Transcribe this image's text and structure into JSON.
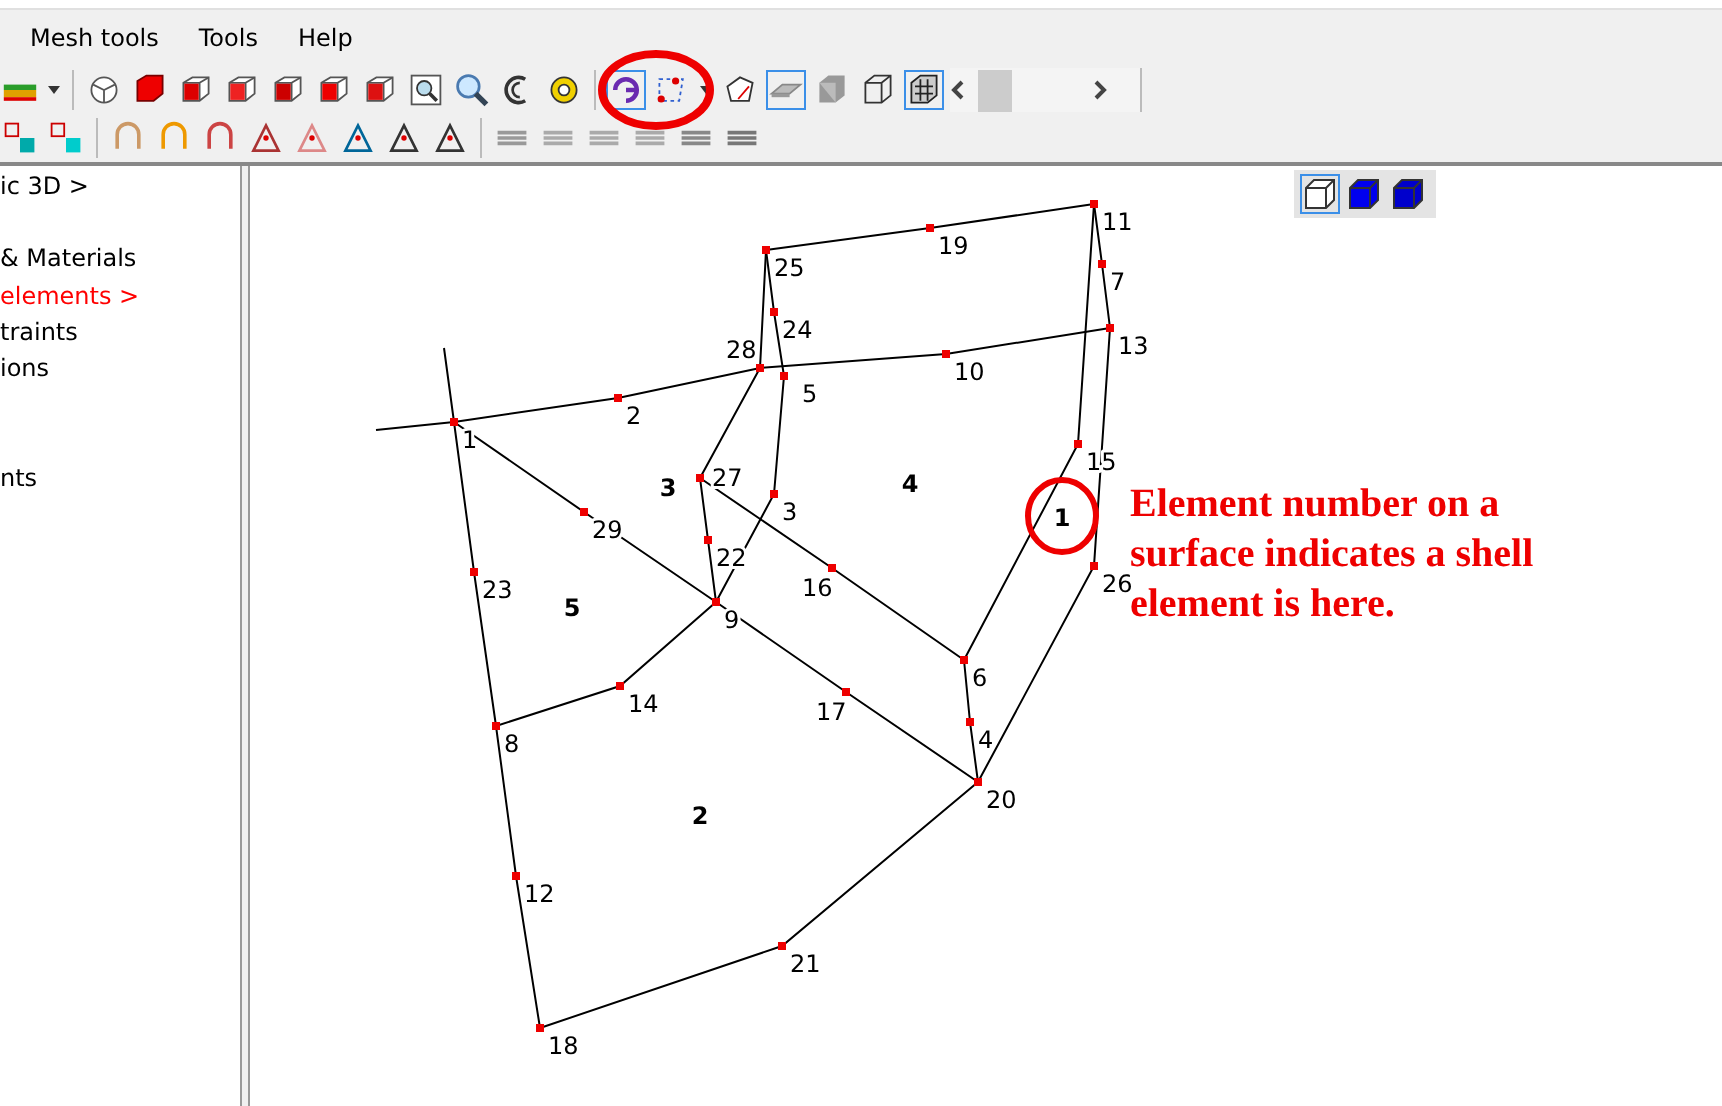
{
  "menu": [
    {
      "label": "Mesh tools"
    },
    {
      "label": "Tools"
    },
    {
      "label": "Help"
    }
  ],
  "toolbar_1": [
    {
      "selected": false
    },
    {
      "selected": false
    },
    {
      "selected": false
    },
    {
      "selected": false
    },
    {
      "selected": false
    },
    {
      "selected": false
    },
    {
      "selected": false
    },
    {
      "selected": false
    },
    {
      "selected": false
    },
    {
      "selected": false
    },
    {
      "selected": false
    },
    {
      "selected": false
    },
    {
      "selected": true
    },
    {
      "selected": false
    },
    {
      "selected": false
    },
    {
      "selected": true
    },
    {
      "selected": false
    },
    {
      "selected": false
    },
    {
      "selected": true
    }
  ],
  "tree": [
    {
      "label": "ic 3D >",
      "selected": false
    },
    {
      "label": "& Materials",
      "selected": false
    },
    {
      "label": "elements >",
      "selected": true
    },
    {
      "label": "traints",
      "selected": false
    },
    {
      "label": "ions",
      "selected": false
    },
    {
      "label": "nts",
      "selected": false
    }
  ],
  "view_buttons": [
    {
      "selected": true
    },
    {
      "selected": false
    },
    {
      "selected": false
    }
  ],
  "mesh": {
    "nodes": [
      "1",
      "2",
      "3",
      "4",
      "5",
      "6",
      "7",
      "8",
      "9",
      "10",
      "11",
      "12",
      "13",
      "14",
      "15",
      "16",
      "17",
      "18",
      "19",
      "20",
      "21",
      "22",
      "23",
      "25",
      "24",
      "26",
      "27",
      "28",
      "29"
    ],
    "elements": [
      "1",
      "2",
      "3",
      "4",
      "5"
    ]
  },
  "callout": {
    "text": "Element number on a surface indicates a shell element is here."
  }
}
